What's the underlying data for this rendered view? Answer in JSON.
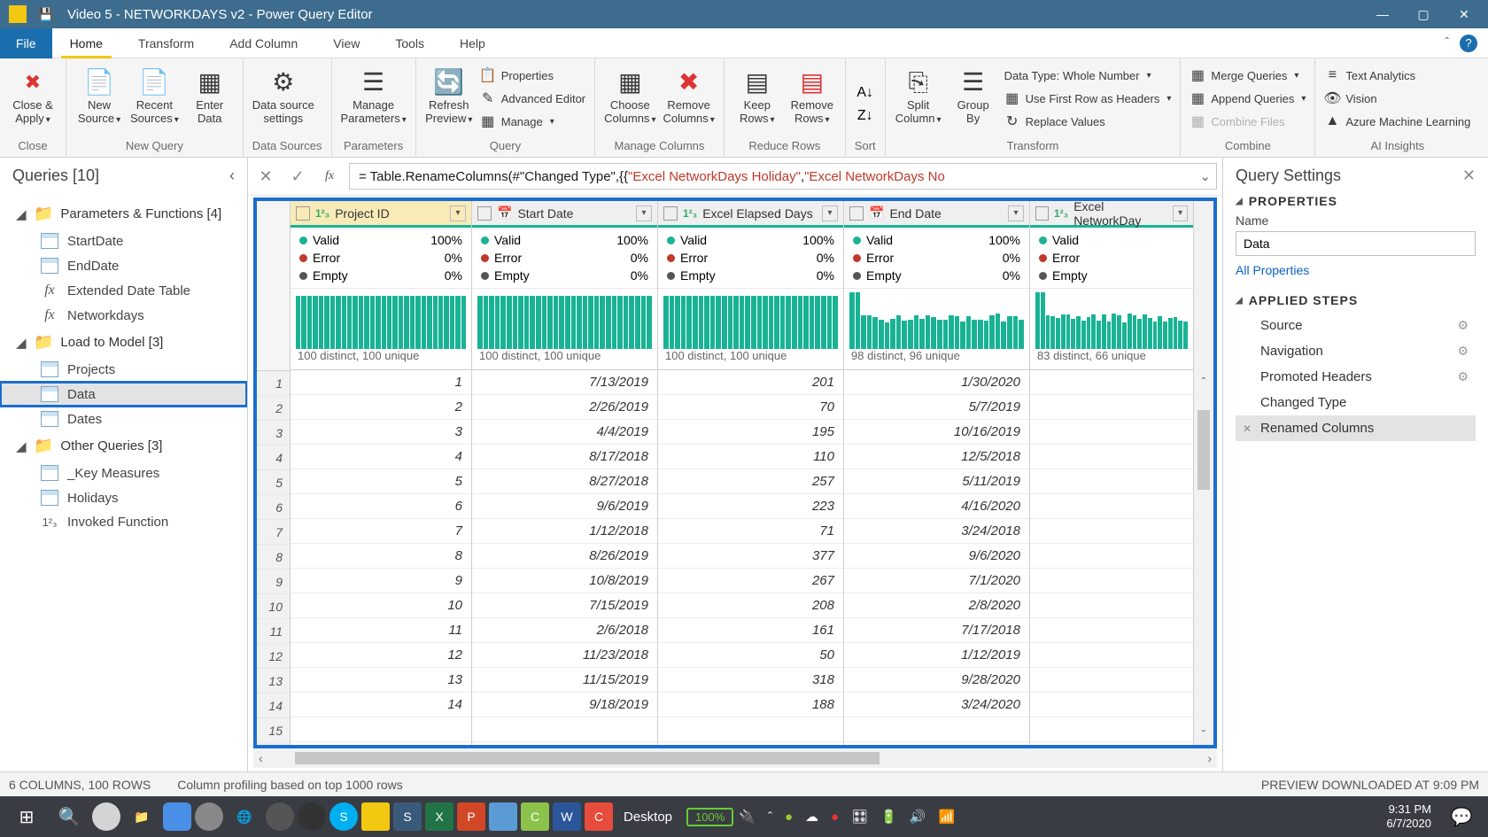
{
  "window": {
    "title": "Video 5 - NETWORKDAYS v2 - Power Query Editor"
  },
  "menu": {
    "file": "File",
    "tabs": [
      "Home",
      "Transform",
      "Add Column",
      "View",
      "Tools",
      "Help"
    ],
    "active": 0
  },
  "ribbon": {
    "close": {
      "b1": "Close &",
      "b2": "Apply",
      "label": "Close"
    },
    "new_query": {
      "b1": "New",
      "b2": "Source",
      "b3": "Recent",
      "b4": "Sources",
      "b5": "Enter",
      "b6": "Data",
      "label": "New Query"
    },
    "data_sources": {
      "b1": "Data source",
      "b2": "settings",
      "label": "Data Sources"
    },
    "parameters": {
      "b1": "Manage",
      "b2": "Parameters",
      "label": "Parameters"
    },
    "query": {
      "b1": "Refresh",
      "b2": "Preview",
      "s1": "Properties",
      "s2": "Advanced Editor",
      "s3": "Manage",
      "label": "Query"
    },
    "manage_cols": {
      "b1": "Choose",
      "b2": "Columns",
      "b3": "Remove",
      "b4": "Columns",
      "label": "Manage Columns"
    },
    "reduce_rows": {
      "b1": "Keep",
      "b2": "Rows",
      "b3": "Remove",
      "b4": "Rows",
      "label": "Reduce Rows"
    },
    "sort": {
      "label": "Sort"
    },
    "split_group": {
      "b1": "Split",
      "b2": "Column",
      "b3": "Group",
      "b4": "By"
    },
    "transform": {
      "s1": "Data Type: Whole Number",
      "s2": "Use First Row as Headers",
      "s3": "Replace Values",
      "label": "Transform"
    },
    "combine": {
      "s1": "Merge Queries",
      "s2": "Append Queries",
      "s3": "Combine Files",
      "label": "Combine"
    },
    "ai": {
      "s1": "Text Analytics",
      "s2": "Vision",
      "s3": "Azure Machine Learning",
      "label": "AI Insights"
    }
  },
  "queries": {
    "title": "Queries [10]",
    "groups": [
      {
        "name": "Parameters & Functions [4]",
        "items": [
          {
            "label": "StartDate",
            "type": "table"
          },
          {
            "label": "EndDate",
            "type": "table"
          },
          {
            "label": "Extended Date Table",
            "type": "fx"
          },
          {
            "label": "Networkdays",
            "type": "fx"
          }
        ]
      },
      {
        "name": "Load to Model [3]",
        "items": [
          {
            "label": "Projects",
            "type": "table"
          },
          {
            "label": "Data",
            "type": "table",
            "selected": true,
            "highlight": true
          },
          {
            "label": "Dates",
            "type": "table"
          }
        ]
      },
      {
        "name": "Other Queries [3]",
        "items": [
          {
            "label": "_Key Measures",
            "type": "table"
          },
          {
            "label": "Holidays",
            "type": "table"
          },
          {
            "label": "Invoked Function",
            "type": "123"
          }
        ]
      }
    ]
  },
  "formula": {
    "prefix": "= Table.RenameColumns(#",
    "arg1": "\"Changed Type\"",
    "mid": ",{{",
    "str1": "\"Excel NetworkDays  Holiday\"",
    "sep": ", ",
    "str2": "\"Excel NetworkDays No"
  },
  "grid": {
    "columns": [
      {
        "name": "Project ID",
        "type": "123",
        "valid": "100%",
        "error": "0%",
        "empty": "0%",
        "distinct": "100 distinct, 100 unique",
        "barsEqual": true
      },
      {
        "name": "Start Date",
        "type": "date",
        "valid": "100%",
        "error": "0%",
        "empty": "0%",
        "distinct": "100 distinct, 100 unique",
        "barsEqual": true
      },
      {
        "name": "Excel Elapsed Days",
        "type": "123",
        "valid": "100%",
        "error": "0%",
        "empty": "0%",
        "distinct": "100 distinct, 100 unique",
        "barsEqual": true
      },
      {
        "name": "End Date",
        "type": "date",
        "valid": "100%",
        "error": "0%",
        "empty": "0%",
        "distinct": "98 distinct, 96 unique",
        "barsEqual": false
      },
      {
        "name": "Excel NetworkDay",
        "type": "123",
        "valid": "",
        "error": "",
        "empty": "",
        "distinct": "83 distinct, 66 unique",
        "barsEqual": false
      }
    ],
    "quality_labels": {
      "valid": "Valid",
      "error": "Error",
      "empty": "Empty"
    },
    "rows": [
      {
        "n": 1,
        "c": [
          "1",
          "7/13/2019",
          "201",
          "1/30/2020",
          ""
        ]
      },
      {
        "n": 2,
        "c": [
          "2",
          "2/26/2019",
          "70",
          "5/7/2019",
          ""
        ]
      },
      {
        "n": 3,
        "c": [
          "3",
          "4/4/2019",
          "195",
          "10/16/2019",
          ""
        ]
      },
      {
        "n": 4,
        "c": [
          "4",
          "8/17/2018",
          "110",
          "12/5/2018",
          ""
        ]
      },
      {
        "n": 5,
        "c": [
          "5",
          "8/27/2018",
          "257",
          "5/11/2019",
          ""
        ]
      },
      {
        "n": 6,
        "c": [
          "6",
          "9/6/2019",
          "223",
          "4/16/2020",
          ""
        ]
      },
      {
        "n": 7,
        "c": [
          "7",
          "1/12/2018",
          "71",
          "3/24/2018",
          ""
        ]
      },
      {
        "n": 8,
        "c": [
          "8",
          "8/26/2019",
          "377",
          "9/6/2020",
          ""
        ]
      },
      {
        "n": 9,
        "c": [
          "9",
          "10/8/2019",
          "267",
          "7/1/2020",
          ""
        ]
      },
      {
        "n": 10,
        "c": [
          "10",
          "7/15/2019",
          "208",
          "2/8/2020",
          ""
        ]
      },
      {
        "n": 11,
        "c": [
          "11",
          "2/6/2018",
          "161",
          "7/17/2018",
          ""
        ]
      },
      {
        "n": 12,
        "c": [
          "12",
          "11/23/2018",
          "50",
          "1/12/2019",
          ""
        ]
      },
      {
        "n": 13,
        "c": [
          "13",
          "11/15/2019",
          "318",
          "9/28/2020",
          ""
        ]
      },
      {
        "n": 14,
        "c": [
          "14",
          "9/18/2019",
          "188",
          "3/24/2020",
          ""
        ]
      },
      {
        "n": 15,
        "c": [
          "",
          "",
          "",
          "",
          ""
        ]
      }
    ]
  },
  "settings": {
    "title": "Query Settings",
    "properties": "PROPERTIES",
    "name_label": "Name",
    "name_value": "Data",
    "all_props": "All Properties",
    "applied": "APPLIED STEPS",
    "steps": [
      {
        "label": "Source",
        "gear": true
      },
      {
        "label": "Navigation",
        "gear": true
      },
      {
        "label": "Promoted Headers",
        "gear": true
      },
      {
        "label": "Changed Type",
        "gear": false
      },
      {
        "label": "Renamed Columns",
        "gear": false,
        "selected": true,
        "x": true
      }
    ]
  },
  "status": {
    "left": "6 COLUMNS, 100 ROWS",
    "mid": "Column profiling based on top 1000 rows",
    "right": "PREVIEW DOWNLOADED AT 9:09 PM"
  },
  "taskbar": {
    "desktop": "Desktop",
    "battery": "100%",
    "time": "9:31 PM",
    "date": "6/7/2020"
  }
}
